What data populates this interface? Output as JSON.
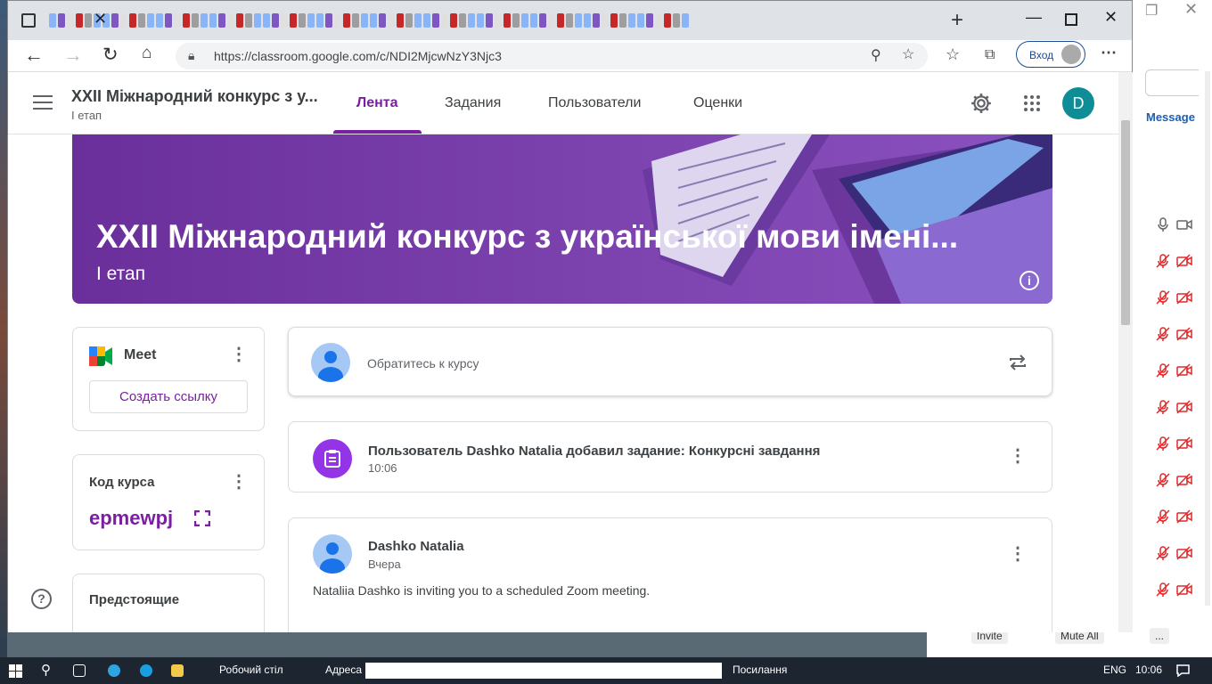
{
  "browser": {
    "url": "https://classroom.google.com/c/NDI2MjcwNzY3Njc3",
    "login_label": "Вход"
  },
  "classroom": {
    "course_title": "XXII Міжнародний конкурс з у...",
    "course_section": "І етап",
    "tabs": [
      {
        "label": "Лента"
      },
      {
        "label": "Задания"
      },
      {
        "label": "Пользователи"
      },
      {
        "label": "Оценки"
      }
    ],
    "avatar_letter": "D",
    "banner": {
      "title": "XXII Міжнародний конкурс з української мови імені...",
      "subtitle": "І етап"
    },
    "meet": {
      "label": "Meet",
      "button": "Создать ссылку"
    },
    "course_code": {
      "title": "Код курса",
      "value": "epmewpj"
    },
    "upcoming": {
      "title": "Предстоящие"
    },
    "share_placeholder": "Обратитесь к курсу",
    "posts": [
      {
        "title": "Пользователь Dashko Natalia добавил задание: Конкурсні завдання",
        "time": "10:06"
      },
      {
        "author": "Dashko Natalia",
        "time": "Вчера",
        "text": "Nataliia Dashko is inviting you to a scheduled Zoom meeting."
      }
    ]
  },
  "zoom_panel": {
    "message_label": "Message",
    "invite_label": "Invite",
    "mute_all_label": "Mute All",
    "more_label": "..."
  },
  "taskbar": {
    "desktop_label": "Робочий стіл",
    "address_label": "Адреса",
    "links_label": "Посилання",
    "language": "ENG",
    "clock": "10:06"
  },
  "colors": {
    "accent": "#7b1fa2",
    "banner": "#7e44b0",
    "avatar_teal": "#0f8d96"
  }
}
